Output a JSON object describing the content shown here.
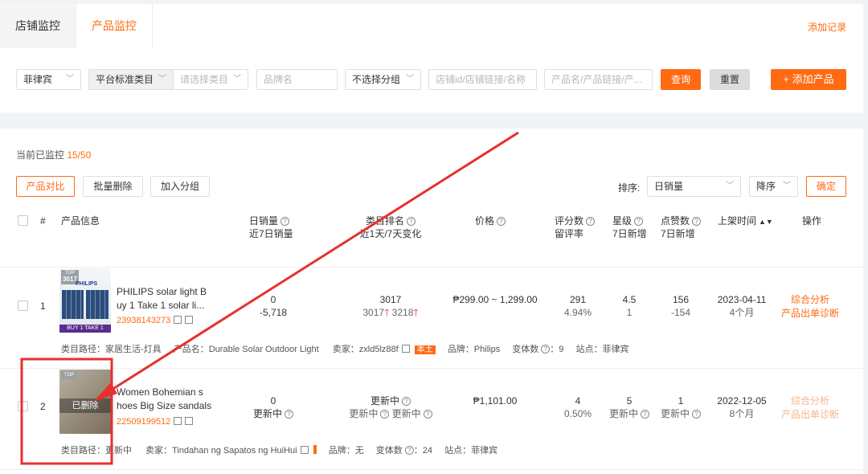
{
  "tabs": [
    {
      "label": "店铺监控",
      "active": false
    },
    {
      "label": "产品监控",
      "active": true
    }
  ],
  "add_record_link": "添加记录",
  "filters": {
    "country": "菲律宾",
    "category_type": "平台标准类目",
    "category_placeholder": "请选择类目",
    "brand_placeholder": "品牌名",
    "group": "不选择分组",
    "shop_placeholder": "店铺id/店铺链接/名称",
    "product_placeholder": "产品名/产品链接/产...",
    "query_button": "查询",
    "reset_button": "重置",
    "add_product_button": "+ 添加产品"
  },
  "monitor": {
    "label": "当前已监控",
    "count": "15/50"
  },
  "actions": {
    "compare": "产品对比",
    "batch_delete": "批量删除",
    "add_group": "加入分组"
  },
  "sort": {
    "label": "排序:",
    "field": "日销量",
    "order": "降序",
    "confirm": "确定"
  },
  "columns": {
    "index": "#",
    "product_info": "产品信息",
    "daily_sales": "日销量",
    "daily_sales_sub": "近7日销量",
    "category_rank": "类目排名",
    "category_rank_sub": "近1天/7天变化",
    "price": "价格",
    "review_count": "评分数",
    "review_rate": "留评率",
    "rating": "星级",
    "rating_sub": "7日新增",
    "likes": "点赞数",
    "likes_sub": "7日新增",
    "listed_time": "上架时间",
    "operation": "操作"
  },
  "rows": [
    {
      "index": "1",
      "title_line1": "PHILIPS solar light B",
      "title_line2": "uy 1 Take 1 solar li...",
      "product_id": "23938143273",
      "thumb_badge": "TOP",
      "thumb_rank": "3017",
      "thumb_brand": "PHILIPS",
      "thumb_banner": "BUY 1 TAKE 1",
      "daily_sales": "0",
      "weekly_sales": "-5,718",
      "rank": "3017",
      "rank_change_1": "3017",
      "rank_change_7": "3218",
      "price": "₱299.00 ~ 1,299.00",
      "reviews": "291",
      "review_rate": "4.94%",
      "rating": "4.5",
      "rating_new": "1",
      "likes": "156",
      "likes_new": "-154",
      "listed_date": "2023-04-11",
      "listed_age": "4个月",
      "action_1": "综合分析",
      "action_2": "产品出单诊断",
      "meta_category": "类目路径：家居生活-灯具",
      "meta_product_name": "产品名：Durable Solar Outdoor Light",
      "meta_seller": "卖家：zxld5lz88f",
      "meta_local_tag": "本土",
      "meta_brand": "品牌：Philips",
      "meta_variants": "变体数",
      "meta_variants_val": "：9",
      "meta_site": "站点：菲律宾"
    },
    {
      "index": "2",
      "title_line1": "Women Bohemian s",
      "title_line2": "hoes Big Size sandals",
      "product_id": "22509199512",
      "thumb_badge": "TOP",
      "thumb_overlay": "已删除",
      "daily_sales": "0",
      "weekly_sales": "更新中",
      "rank": "更新中",
      "rank_change_1": "更新中",
      "rank_change_7": "更新中",
      "price": "₱1,101.00",
      "reviews": "4",
      "review_rate": "0.50%",
      "rating": "5",
      "rating_new": "更新中",
      "likes": "1",
      "likes_new": "更新中",
      "listed_date": "2022-12-05",
      "listed_age": "8个月",
      "action_1": "综合分析",
      "action_2": "产品出单诊断",
      "meta_category": "类目路径：更新中",
      "meta_seller": "卖家：Tindahan ng Sapatos ng HuiHui",
      "meta_brand": "品牌：无",
      "meta_variants": "变体数",
      "meta_variants_val": "：24",
      "meta_site": "站点：菲律宾"
    }
  ],
  "colors": {
    "accent": "#ff6a13",
    "annotation": "#e8302f"
  }
}
